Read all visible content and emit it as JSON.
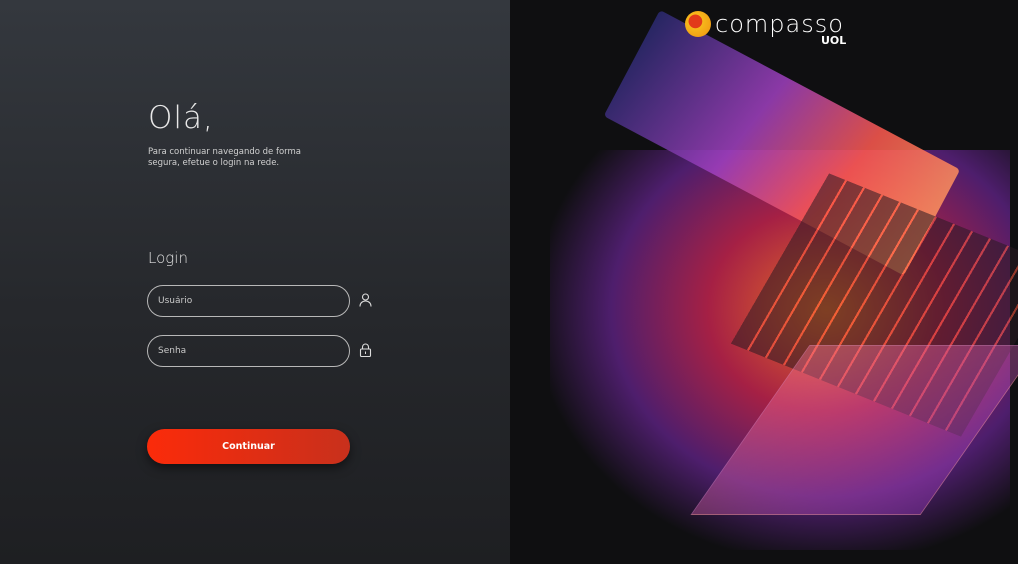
{
  "brand": {
    "name": "compasso",
    "sub": "UOL"
  },
  "greeting": "Olá,",
  "subtitle": "Para continuar navegando de forma segura, efetue o login na rede.",
  "login": {
    "heading": "Login",
    "username_placeholder": "Usuário",
    "password_placeholder": "Senha",
    "submit_label": "Continuar"
  },
  "colors": {
    "accent": "#fb2b0a"
  }
}
